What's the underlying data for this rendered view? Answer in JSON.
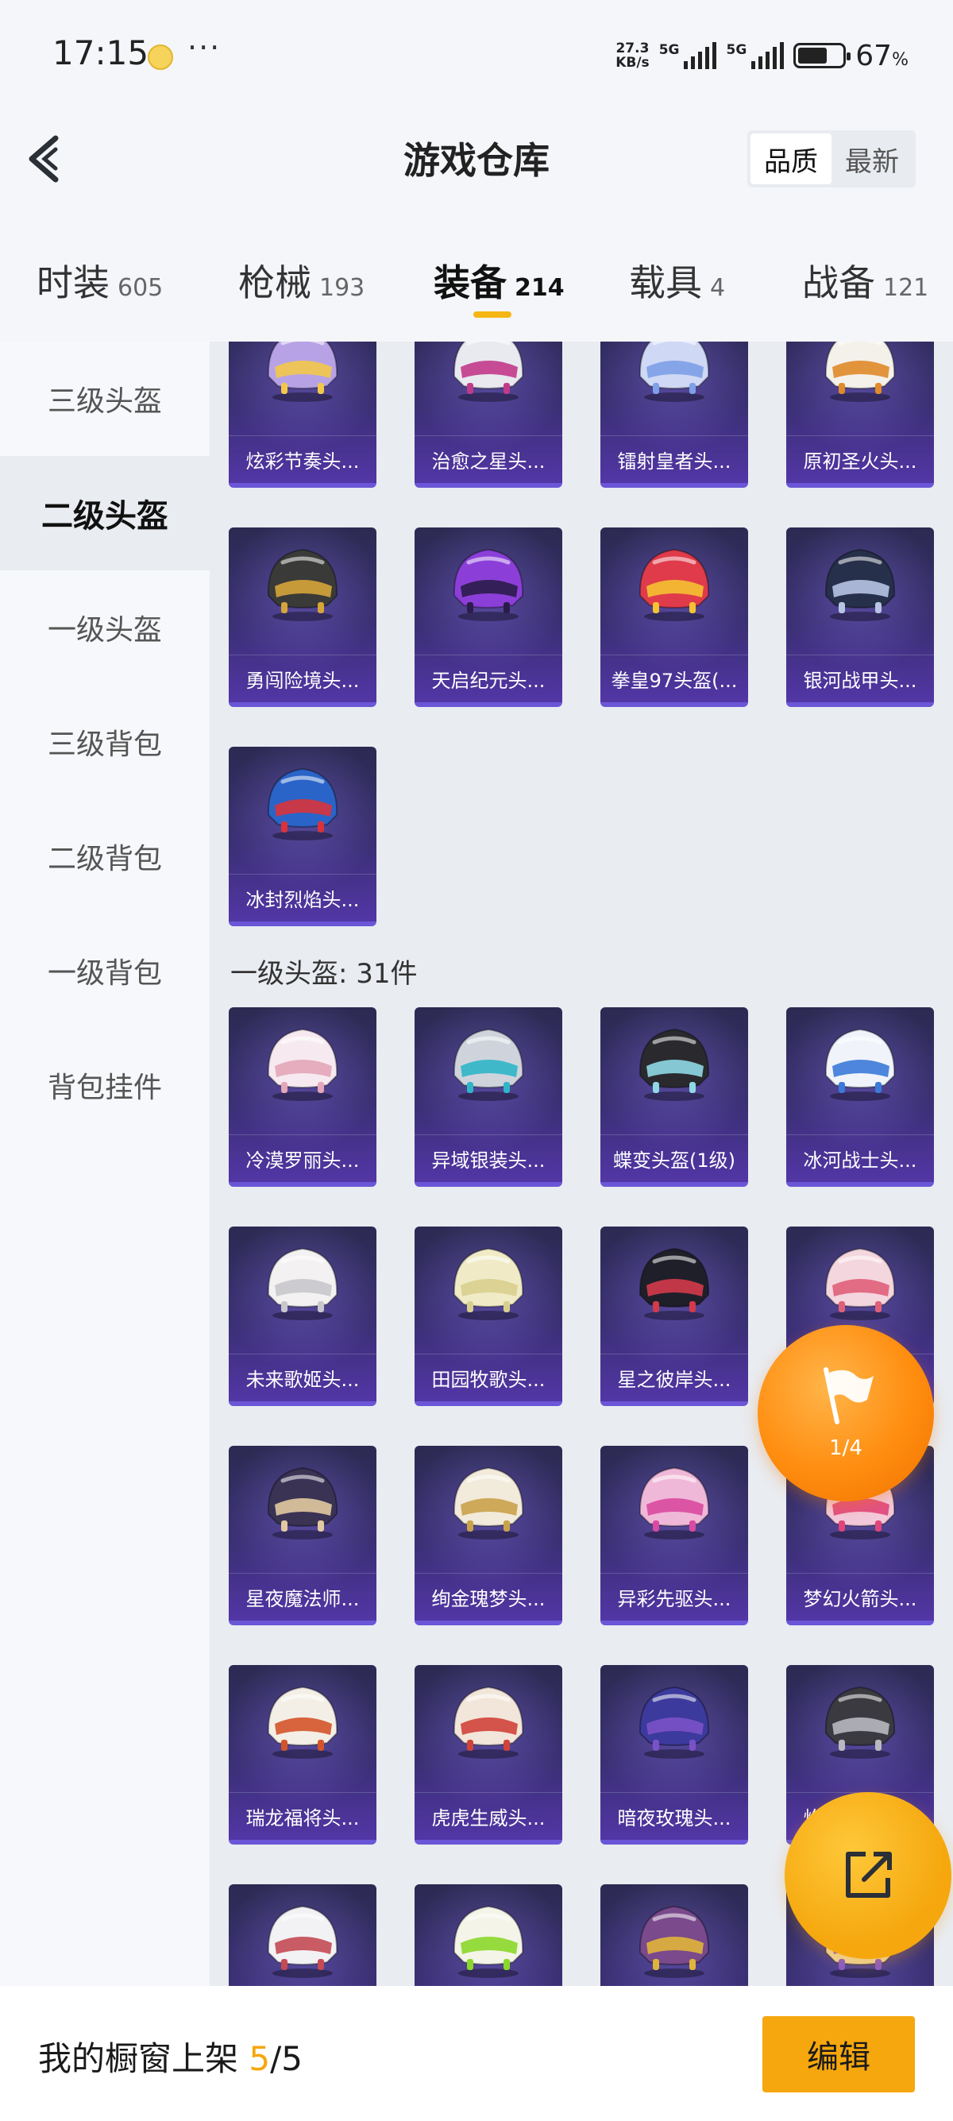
{
  "status_bar": {
    "time": "17:15",
    "net_speed_value": "27.3",
    "net_speed_unit": "KB/s",
    "sim1": "5G",
    "sim2": "5G",
    "battery_percent": "67",
    "battery_unit": "%",
    "battery_level": 0.67
  },
  "header": {
    "title": "游戏仓库",
    "sort": {
      "quality": "品质",
      "latest": "最新",
      "active": "quality"
    }
  },
  "tabs": [
    {
      "name": "时装",
      "count": "605"
    },
    {
      "name": "枪械",
      "count": "193"
    },
    {
      "name": "装备",
      "count": "214",
      "active": true
    },
    {
      "name": "载具",
      "count": "4"
    },
    {
      "name": "战备",
      "count": "121"
    }
  ],
  "sidebar": [
    {
      "label": "三级头盔"
    },
    {
      "label": "二级头盔",
      "active": true
    },
    {
      "label": "一级头盔"
    },
    {
      "label": "三级背包"
    },
    {
      "label": "二级背包"
    },
    {
      "label": "一级背包"
    },
    {
      "label": "背包挂件"
    }
  ],
  "level2_items": [
    {
      "name": "炫彩节奏头...",
      "colors": [
        "#b8a2e6",
        "#f2c84a"
      ]
    },
    {
      "name": "治愈之星头...",
      "colors": [
        "#e9e9f0",
        "#c23a8a"
      ]
    },
    {
      "name": "镭射皇者头...",
      "colors": [
        "#cfd8f4",
        "#7da0e8"
      ]
    },
    {
      "name": "原初圣火头...",
      "colors": [
        "#f4f1ea",
        "#e08a2a"
      ]
    },
    {
      "name": "勇闯险境头...",
      "colors": [
        "#3a3a38",
        "#d6a53a"
      ]
    },
    {
      "name": "天启纪元头...",
      "colors": [
        "#8b3fd8",
        "#2b1c4a"
      ]
    },
    {
      "name": "拳皇97头盔(...",
      "colors": [
        "#e03b4a",
        "#f5c232"
      ]
    },
    {
      "name": "银河战甲头...",
      "colors": [
        "#27304a",
        "#b8c4e4"
      ]
    },
    {
      "name": "冰封烈焰头...",
      "colors": [
        "#2b64c8",
        "#d8333a"
      ]
    }
  ],
  "level1_section": {
    "title": "一级头盔: 31件"
  },
  "level1_items": [
    {
      "name": "冷漠罗丽头...",
      "colors": [
        "#f6eaf0",
        "#e4a6b8"
      ]
    },
    {
      "name": "异域银装头...",
      "colors": [
        "#cfd4dc",
        "#2fb6c8"
      ]
    },
    {
      "name": "蝶变头盔(1级)",
      "colors": [
        "#2a2a2e",
        "#8fd8e4"
      ]
    },
    {
      "name": "冰河战士头...",
      "colors": [
        "#f0f4fa",
        "#3b7ad8"
      ]
    },
    {
      "name": "未来歌姬头...",
      "colors": [
        "#f3f1f1",
        "#c8c8cc"
      ]
    },
    {
      "name": "田园牧歌头...",
      "colors": [
        "#f0ebc6",
        "#d8cf8e"
      ]
    },
    {
      "name": "星之彼岸头...",
      "colors": [
        "#1f1f2a",
        "#d43a4a"
      ]
    },
    {
      "name": "",
      "colors": [
        "#f4d6de",
        "#e0607a"
      ]
    },
    {
      "name": "星夜魔法师...",
      "colors": [
        "#3a3354",
        "#e2c9a0"
      ]
    },
    {
      "name": "绚金瑰梦头...",
      "colors": [
        "#f2eada",
        "#c9a24a"
      ]
    },
    {
      "name": "异彩先驱头...",
      "colors": [
        "#f0b8d8",
        "#d94aa0"
      ]
    },
    {
      "name": "梦幻火箭头...",
      "colors": [
        "#f3c8da",
        "#e0447a"
      ]
    },
    {
      "name": "瑞龙福将头...",
      "colors": [
        "#f4efe6",
        "#d4542a"
      ]
    },
    {
      "name": "虎虎生威头...",
      "colors": [
        "#f2e6da",
        "#d0433a"
      ]
    },
    {
      "name": "暗夜玫瑰头...",
      "colors": [
        "#3c3a9c",
        "#7a52c8"
      ]
    },
    {
      "name": "焰龙破天头...",
      "colors": [
        "#3a3a40",
        "#b8b8c0"
      ]
    },
    {
      "name": "",
      "colors": [
        "#f2f2f4",
        "#c44a54"
      ]
    },
    {
      "name": "",
      "colors": [
        "#f4f4e8",
        "#8cd82a"
      ]
    },
    {
      "name": "",
      "colors": [
        "#7a4a8c",
        "#e0b43a"
      ]
    },
    {
      "name": "",
      "colors": [
        "#f0d8a0",
        "#8a5ac8"
      ]
    }
  ],
  "floating": {
    "flag_count": "1/4"
  },
  "bottom_bar": {
    "label": "我的橱窗上架",
    "count_current": "5",
    "count_sep": "/",
    "count_total": "5",
    "edit_label": "编辑"
  },
  "theme": {
    "accent": "#f5a70d",
    "tab_underline": "#f5b614"
  }
}
